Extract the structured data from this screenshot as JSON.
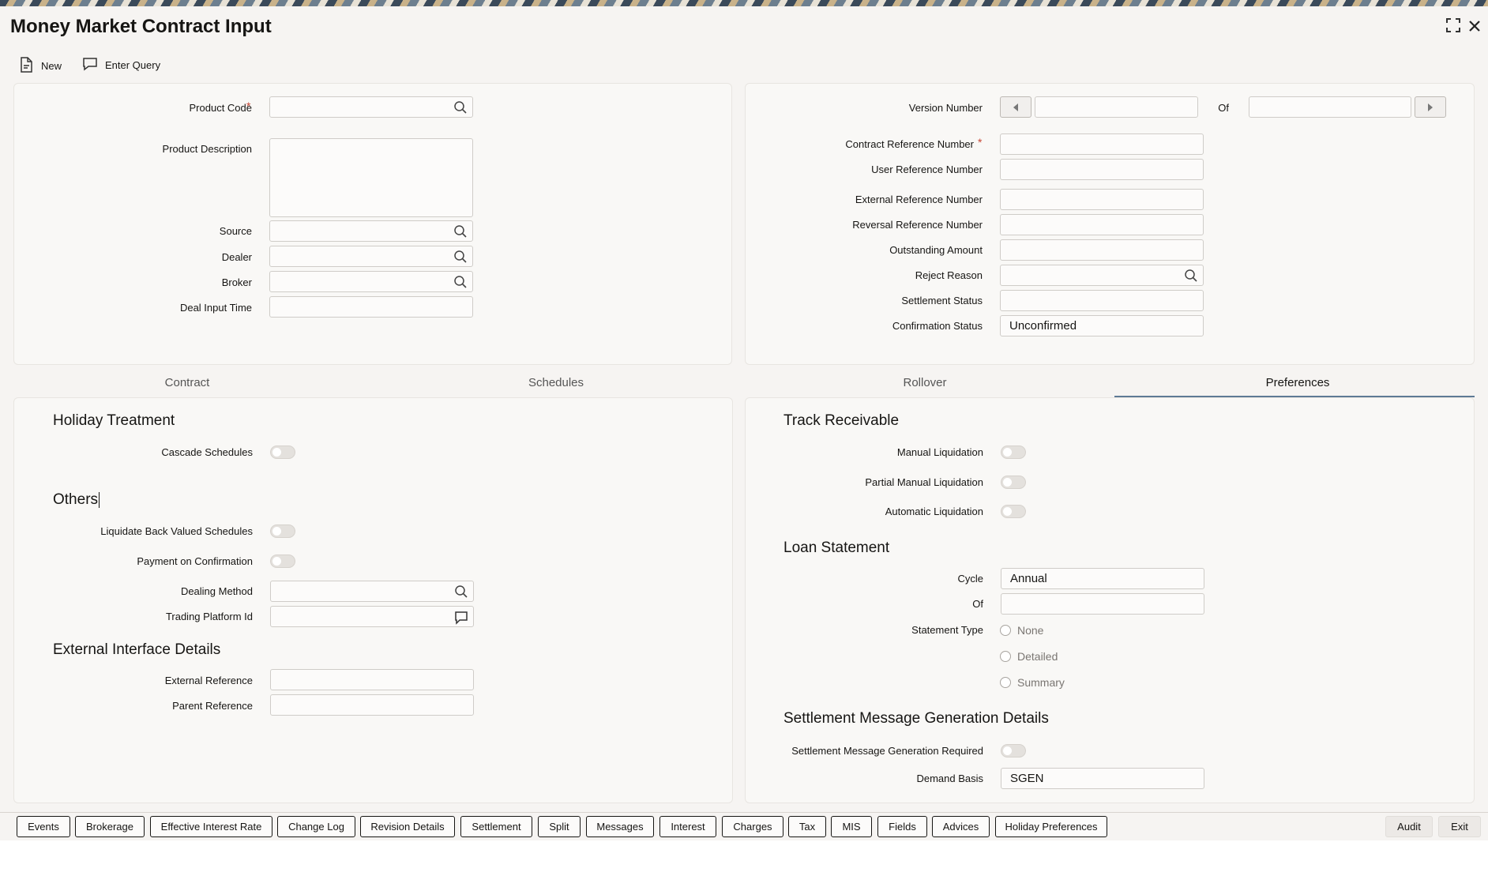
{
  "window": {
    "title": "Money Market Contract Input",
    "maximize_icon": "expand-icon",
    "close_icon": "close-icon"
  },
  "toolbar": {
    "new_label": "New",
    "enter_query_label": "Enter Query"
  },
  "header_left": {
    "product_code_label": "Product Code",
    "required_mark": "*",
    "product_description_label": "Product Description",
    "source_label": "Source",
    "dealer_label": "Dealer",
    "broker_label": "Broker",
    "deal_input_time_label": "Deal Input Time"
  },
  "header_right": {
    "version_number_label": "Version Number",
    "of_label": "Of",
    "contract_reference_label": "Contract Reference Number",
    "user_reference_label": "User Reference Number",
    "external_reference_label": "External Reference Number",
    "reversal_reference_label": "Reversal Reference Number",
    "outstanding_amount_label": "Outstanding Amount",
    "reject_reason_label": "Reject Reason",
    "settlement_status_label": "Settlement Status",
    "confirmation_status_label": "Confirmation Status",
    "confirmation_status_value": "Unconfirmed"
  },
  "tabs": [
    {
      "label": "Contract"
    },
    {
      "label": "Schedules"
    },
    {
      "label": "Rollover"
    },
    {
      "label": "Preferences"
    }
  ],
  "preferences_left": {
    "holiday_treatment_heading": "Holiday Treatment",
    "cascade_schedules_label": "Cascade Schedules",
    "others_heading": "Others",
    "liquidate_back_valued_label": "Liquidate Back Valued Schedules",
    "payment_on_confirmation_label": "Payment on Confirmation",
    "dealing_method_label": "Dealing Method",
    "trading_platform_label": "Trading Platform Id",
    "external_interface_heading": "External Interface Details",
    "external_reference_label": "External Reference",
    "parent_reference_label": "Parent Reference"
  },
  "preferences_right": {
    "track_receivable_heading": "Track Receivable",
    "manual_liquidation_label": "Manual Liquidation",
    "partial_manual_liquidation_label": "Partial Manual Liquidation",
    "automatic_liquidation_label": "Automatic Liquidation",
    "loan_statement_heading": "Loan Statement",
    "cycle_label": "Cycle",
    "cycle_value": "Annual",
    "of_label": "Of",
    "statement_type_label": "Statement Type",
    "statement_options": [
      "None",
      "Detailed",
      "Summary"
    ],
    "settlement_msg_heading": "Settlement Message Generation Details",
    "settlement_msg_required_label": "Settlement Message Generation Required",
    "demand_basis_label": "Demand Basis",
    "demand_basis_value": "SGEN"
  },
  "footer": {
    "buttons": [
      "Events",
      "Brokerage",
      "Effective Interest Rate",
      "Change Log",
      "Revision Details",
      "Settlement",
      "Split",
      "Messages",
      "Interest",
      "Charges",
      "Tax",
      "MIS",
      "Fields",
      "Advices",
      "Holiday Preferences"
    ],
    "audit_label": "Audit",
    "exit_label": "Exit"
  }
}
